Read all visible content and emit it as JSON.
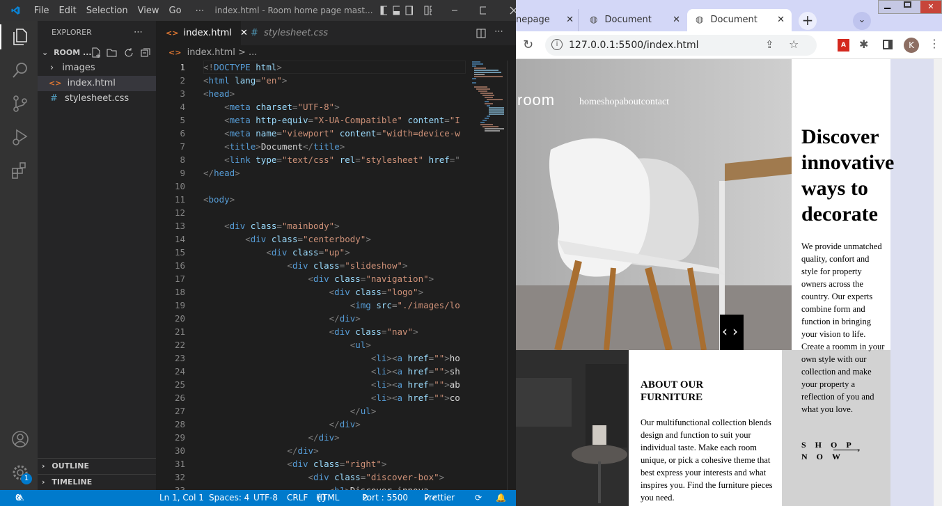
{
  "vscode": {
    "menu": [
      "File",
      "Edit",
      "Selection",
      "View",
      "Go",
      "⋯"
    ],
    "window_title": "index.html - Room home page mast...",
    "explorer": {
      "title": "EXPLORER",
      "folder": "ROOM ...",
      "items": [
        "images",
        "index.html",
        "stylesheet.css"
      ],
      "outline": "OUTLINE",
      "timeline": "TIMELINE"
    },
    "tabs": [
      "index.html",
      "stylesheet.css"
    ],
    "breadcrumb": "index.html > ...",
    "code_lines": [
      [
        [
          "pu",
          "<!"
        ],
        [
          "tg",
          "DOCTYPE"
        ],
        [
          "at",
          " html"
        ],
        [
          "pu",
          ">"
        ]
      ],
      [
        [
          "pu",
          "<"
        ],
        [
          "tg",
          "html"
        ],
        [
          "at",
          " lang"
        ],
        [
          "pu",
          "="
        ],
        [
          "st",
          "\"en\""
        ],
        [
          "pu",
          ">"
        ]
      ],
      [
        [
          "pu",
          "<"
        ],
        [
          "tg",
          "head"
        ],
        [
          "pu",
          ">"
        ]
      ],
      [
        [
          "",
          "    "
        ],
        [
          "pu",
          "<"
        ],
        [
          "tg",
          "meta"
        ],
        [
          "at",
          " charset"
        ],
        [
          "pu",
          "="
        ],
        [
          "st",
          "\"UTF-8\""
        ],
        [
          "pu",
          ">"
        ]
      ],
      [
        [
          "",
          "    "
        ],
        [
          "pu",
          "<"
        ],
        [
          "tg",
          "meta"
        ],
        [
          "at",
          " http-equiv"
        ],
        [
          "pu",
          "="
        ],
        [
          "st",
          "\"X-UA-Compatible\""
        ],
        [
          "at",
          " content"
        ],
        [
          "pu",
          "="
        ],
        [
          "st",
          "\"I"
        ]
      ],
      [
        [
          "",
          "    "
        ],
        [
          "pu",
          "<"
        ],
        [
          "tg",
          "meta"
        ],
        [
          "at",
          " name"
        ],
        [
          "pu",
          "="
        ],
        [
          "st",
          "\"viewport\""
        ],
        [
          "at",
          " content"
        ],
        [
          "pu",
          "="
        ],
        [
          "st",
          "\"width=device-w"
        ]
      ],
      [
        [
          "",
          "    "
        ],
        [
          "pu",
          "<"
        ],
        [
          "tg",
          "title"
        ],
        [
          "pu",
          ">"
        ],
        [
          "",
          "Document"
        ],
        [
          "pu",
          "</"
        ],
        [
          "tg",
          "title"
        ],
        [
          "pu",
          ">"
        ]
      ],
      [
        [
          "",
          "    "
        ],
        [
          "pu",
          "<"
        ],
        [
          "tg",
          "link"
        ],
        [
          "at",
          " type"
        ],
        [
          "pu",
          "="
        ],
        [
          "st",
          "\"text/css\""
        ],
        [
          "at",
          " rel"
        ],
        [
          "pu",
          "="
        ],
        [
          "st",
          "\"stylesheet\""
        ],
        [
          "at",
          " href"
        ],
        [
          "pu",
          "=\""
        ]
      ],
      [
        [
          "pu",
          "</"
        ],
        [
          "tg",
          "head"
        ],
        [
          "pu",
          ">"
        ]
      ],
      [
        [
          "",
          ""
        ]
      ],
      [
        [
          "pu",
          "<"
        ],
        [
          "tg",
          "body"
        ],
        [
          "pu",
          ">"
        ]
      ],
      [
        [
          "",
          ""
        ]
      ],
      [
        [
          "",
          "    "
        ],
        [
          "pu",
          "<"
        ],
        [
          "tg",
          "div"
        ],
        [
          "at",
          " class"
        ],
        [
          "pu",
          "="
        ],
        [
          "st",
          "\"mainbody\""
        ],
        [
          "pu",
          ">"
        ]
      ],
      [
        [
          "",
          "        "
        ],
        [
          "pu",
          "<"
        ],
        [
          "tg",
          "div"
        ],
        [
          "at",
          " class"
        ],
        [
          "pu",
          "="
        ],
        [
          "st",
          "\"centerbody\""
        ],
        [
          "pu",
          ">"
        ]
      ],
      [
        [
          "",
          "            "
        ],
        [
          "pu",
          "<"
        ],
        [
          "tg",
          "div"
        ],
        [
          "at",
          " class"
        ],
        [
          "pu",
          "="
        ],
        [
          "st",
          "\"up\""
        ],
        [
          "pu",
          ">"
        ]
      ],
      [
        [
          "",
          "                "
        ],
        [
          "pu",
          "<"
        ],
        [
          "tg",
          "div"
        ],
        [
          "at",
          " class"
        ],
        [
          "pu",
          "="
        ],
        [
          "st",
          "\"slideshow\""
        ],
        [
          "pu",
          ">"
        ]
      ],
      [
        [
          "",
          "                    "
        ],
        [
          "pu",
          "<"
        ],
        [
          "tg",
          "div"
        ],
        [
          "at",
          " class"
        ],
        [
          "pu",
          "="
        ],
        [
          "st",
          "\"navigation\""
        ],
        [
          "pu",
          ">"
        ]
      ],
      [
        [
          "",
          "                        "
        ],
        [
          "pu",
          "<"
        ],
        [
          "tg",
          "div"
        ],
        [
          "at",
          " class"
        ],
        [
          "pu",
          "="
        ],
        [
          "st",
          "\"logo\""
        ],
        [
          "pu",
          ">"
        ]
      ],
      [
        [
          "",
          "                            "
        ],
        [
          "pu",
          "<"
        ],
        [
          "tg",
          "img"
        ],
        [
          "at",
          " src"
        ],
        [
          "pu",
          "="
        ],
        [
          "st",
          "\"./images/lo"
        ]
      ],
      [
        [
          "",
          "                        "
        ],
        [
          "pu",
          "</"
        ],
        [
          "tg",
          "div"
        ],
        [
          "pu",
          ">"
        ]
      ],
      [
        [
          "",
          "                        "
        ],
        [
          "pu",
          "<"
        ],
        [
          "tg",
          "div"
        ],
        [
          "at",
          " class"
        ],
        [
          "pu",
          "="
        ],
        [
          "st",
          "\"nav\""
        ],
        [
          "pu",
          ">"
        ]
      ],
      [
        [
          "",
          "                            "
        ],
        [
          "pu",
          "<"
        ],
        [
          "tg",
          "ul"
        ],
        [
          "pu",
          ">"
        ]
      ],
      [
        [
          "",
          "                                "
        ],
        [
          "pu",
          "<"
        ],
        [
          "tg",
          "li"
        ],
        [
          "pu",
          "><"
        ],
        [
          "tg",
          "a"
        ],
        [
          "at",
          " href"
        ],
        [
          "pu",
          "="
        ],
        [
          "st",
          "\"\""
        ],
        [
          "pu",
          ">"
        ],
        [
          "",
          "ho"
        ]
      ],
      [
        [
          "",
          "                                "
        ],
        [
          "pu",
          "<"
        ],
        [
          "tg",
          "li"
        ],
        [
          "pu",
          "><"
        ],
        [
          "tg",
          "a"
        ],
        [
          "at",
          " href"
        ],
        [
          "pu",
          "="
        ],
        [
          "st",
          "\"\""
        ],
        [
          "pu",
          ">"
        ],
        [
          "",
          "sh"
        ]
      ],
      [
        [
          "",
          "                                "
        ],
        [
          "pu",
          "<"
        ],
        [
          "tg",
          "li"
        ],
        [
          "pu",
          "><"
        ],
        [
          "tg",
          "a"
        ],
        [
          "at",
          " href"
        ],
        [
          "pu",
          "="
        ],
        [
          "st",
          "\"\""
        ],
        [
          "pu",
          ">"
        ],
        [
          "",
          "ab"
        ]
      ],
      [
        [
          "",
          "                                "
        ],
        [
          "pu",
          "<"
        ],
        [
          "tg",
          "li"
        ],
        [
          "pu",
          "><"
        ],
        [
          "tg",
          "a"
        ],
        [
          "at",
          " href"
        ],
        [
          "pu",
          "="
        ],
        [
          "st",
          "\"\""
        ],
        [
          "pu",
          ">"
        ],
        [
          "",
          "co"
        ]
      ],
      [
        [
          "",
          "                            "
        ],
        [
          "pu",
          "</"
        ],
        [
          "tg",
          "ul"
        ],
        [
          "pu",
          ">"
        ]
      ],
      [
        [
          "",
          "                        "
        ],
        [
          "pu",
          "</"
        ],
        [
          "tg",
          "div"
        ],
        [
          "pu",
          ">"
        ]
      ],
      [
        [
          "",
          "                    "
        ],
        [
          "pu",
          "</"
        ],
        [
          "tg",
          "div"
        ],
        [
          "pu",
          ">"
        ]
      ],
      [
        [
          "",
          "                "
        ],
        [
          "pu",
          "</"
        ],
        [
          "tg",
          "div"
        ],
        [
          "pu",
          ">"
        ]
      ],
      [
        [
          "",
          "                "
        ],
        [
          "pu",
          "<"
        ],
        [
          "tg",
          "div"
        ],
        [
          "at",
          " class"
        ],
        [
          "pu",
          "="
        ],
        [
          "st",
          "\"right\""
        ],
        [
          "pu",
          ">"
        ]
      ],
      [
        [
          "",
          "                    "
        ],
        [
          "pu",
          "<"
        ],
        [
          "tg",
          "div"
        ],
        [
          "at",
          " class"
        ],
        [
          "pu",
          "="
        ],
        [
          "st",
          "\"discover-box\""
        ],
        [
          "pu",
          ">"
        ]
      ],
      [
        [
          "",
          "                        "
        ],
        [
          "pu",
          "<"
        ],
        [
          "tg",
          "h1"
        ],
        [
          "pu",
          ">"
        ],
        [
          "",
          "Discover innova"
        ]
      ]
    ],
    "status": {
      "errors": "0",
      "warnings": "0",
      "position": "Ln 1, Col 1",
      "spaces": "Spaces: 4",
      "encoding": "UTF-8",
      "eol": "CRLF",
      "language": "HTML",
      "port": "Port : 5500",
      "prettier": "Prettier",
      "badge": "1"
    }
  },
  "browser": {
    "tabs": [
      "nepage",
      "Document",
      "Document"
    ],
    "url": "127.0.0.1:5500/index.html",
    "profile": "K",
    "page": {
      "logo": "room",
      "nav": "homeshopaboutcontact",
      "heading": "Discover innovative ways to decorate",
      "paragraph": "We provide unmatched quality, confort and style for property owners across the country. Our experts combine form and function in bringing your vision to life. Create a roomm in your own style with our collection and make your property a reflection of you and what you love.",
      "shop_now": "SHOP NOW",
      "about_title": "ABOUT OUR FURNITURE",
      "about_text": "Our multifunctional collection blends design and function to suit your individual taste. Make each room unique, or pick a cohesive theme that best express your interests and what inspires you. Find the furniture pieces you need."
    }
  }
}
